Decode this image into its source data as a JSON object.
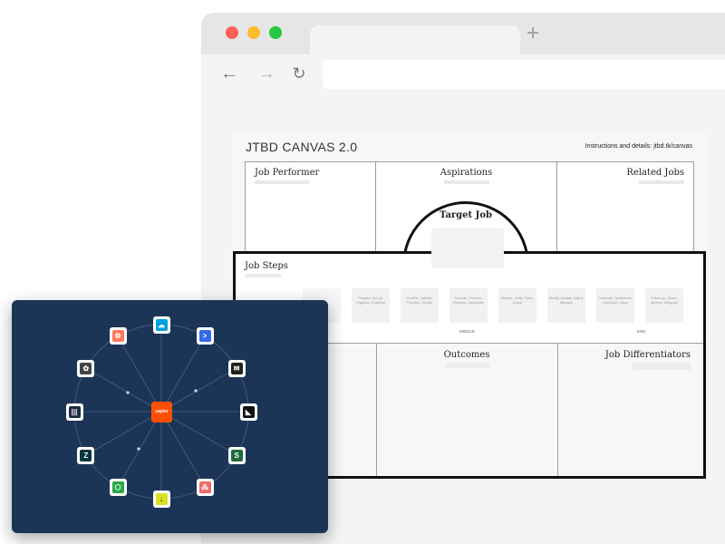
{
  "browser": {
    "new_tab_icon": "plus-icon",
    "nav": {
      "back_icon": "back-arrow-icon",
      "forward_icon": "forward-arrow-icon",
      "reload_icon": "reload-icon"
    }
  },
  "canvas": {
    "title": "JTBD CANVAS 2.0",
    "note": "Instructions and details: jtbd.tk/canvas",
    "cells": {
      "job_performer": "Job Performer",
      "aspirations": "Aspirations",
      "related_jobs": "Related Jobs",
      "target_job": "Target Job",
      "job_steps": "Job Steps",
      "outcomes": "Outcomes",
      "job_differentiators": "Job Differentiators"
    },
    "steps": [
      "Prepare, Set up, Organize, Examine",
      "Confirm, Validate, Prioritize, Decide",
      "Execute, Perform, Transact, Administer",
      "Monitor, Verify, Track, Check",
      "Modify, Update, Adjust, Maintain",
      "Conclude, Synthesize, Conclude, Close",
      "Follow up, Share, Archive, Integrate"
    ],
    "stage_labels": {
      "middle": "MIDDLE",
      "end": "END"
    }
  },
  "integrations": {
    "hub_label": "zapier",
    "apps": [
      {
        "name": "salesforce",
        "icon": "salesforce-icon",
        "color": "#00a1e0"
      },
      {
        "name": "activecampaign",
        "icon": "activecampaign-icon",
        "color": "#356ae6"
      },
      {
        "name": "mailchimp",
        "icon": "mailchimp-icon",
        "color": "#222222"
      },
      {
        "name": "kit",
        "icon": "kit-icon",
        "color": "#111111"
      },
      {
        "name": "sheets",
        "icon": "sheets-icon",
        "color": "#1e6b3a"
      },
      {
        "name": "asana",
        "icon": "asana-icon",
        "color": "#f06a6a"
      },
      {
        "name": "download",
        "icon": "download-icon",
        "color": "#d9e021"
      },
      {
        "name": "hex",
        "icon": "hex-icon",
        "color": "#2aa84a"
      },
      {
        "name": "zendesk",
        "icon": "zendesk-icon",
        "color": "#03363d"
      },
      {
        "name": "intercom",
        "icon": "intercom-icon",
        "color": "#1f2a44"
      },
      {
        "name": "openai",
        "icon": "openai-icon",
        "color": "#444444"
      },
      {
        "name": "hubspot",
        "icon": "hubspot-icon",
        "color": "#ff7a59"
      }
    ]
  },
  "colors": {
    "card_bg": "#1c3557",
    "hub": "#ff4f00"
  }
}
